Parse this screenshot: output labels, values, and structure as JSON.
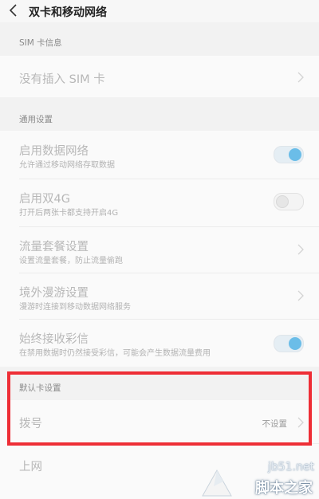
{
  "header": {
    "title": "双卡和移动网络"
  },
  "sim_section": {
    "label": "SIM 卡信息",
    "item": "没有插入 SIM 卡"
  },
  "general_section": {
    "label": "通用设置",
    "items": [
      {
        "title": "启用数据网络",
        "subtitle": "允许通过移动网络存取数据",
        "control": "toggle",
        "state": "on"
      },
      {
        "title": "启用双4G",
        "subtitle": "打开后两张卡都支持开启4G",
        "control": "toggle",
        "state": "off"
      },
      {
        "title": "流量套餐设置",
        "subtitle": "设置流量套餐，防止流量偷跑",
        "control": "chevron"
      },
      {
        "title": "境外漫游设置",
        "subtitle": "漫游时连接到移动数据网络服务",
        "control": "chevron"
      },
      {
        "title": "始终接收彩信",
        "subtitle": "在禁用数据时仍然接受彩信，可能会产生数据流量费用",
        "control": "toggle",
        "state": "on"
      }
    ]
  },
  "default_card_section": {
    "label": "默认卡设置",
    "items": [
      {
        "title": "拨号",
        "value": "不设置"
      },
      {
        "title": "上网"
      }
    ]
  },
  "watermark": {
    "url": "jb51.net",
    "name": "脚本之家"
  },
  "colors": {
    "toggle_on": "#6bbde8",
    "highlight": "#ee2e36"
  }
}
